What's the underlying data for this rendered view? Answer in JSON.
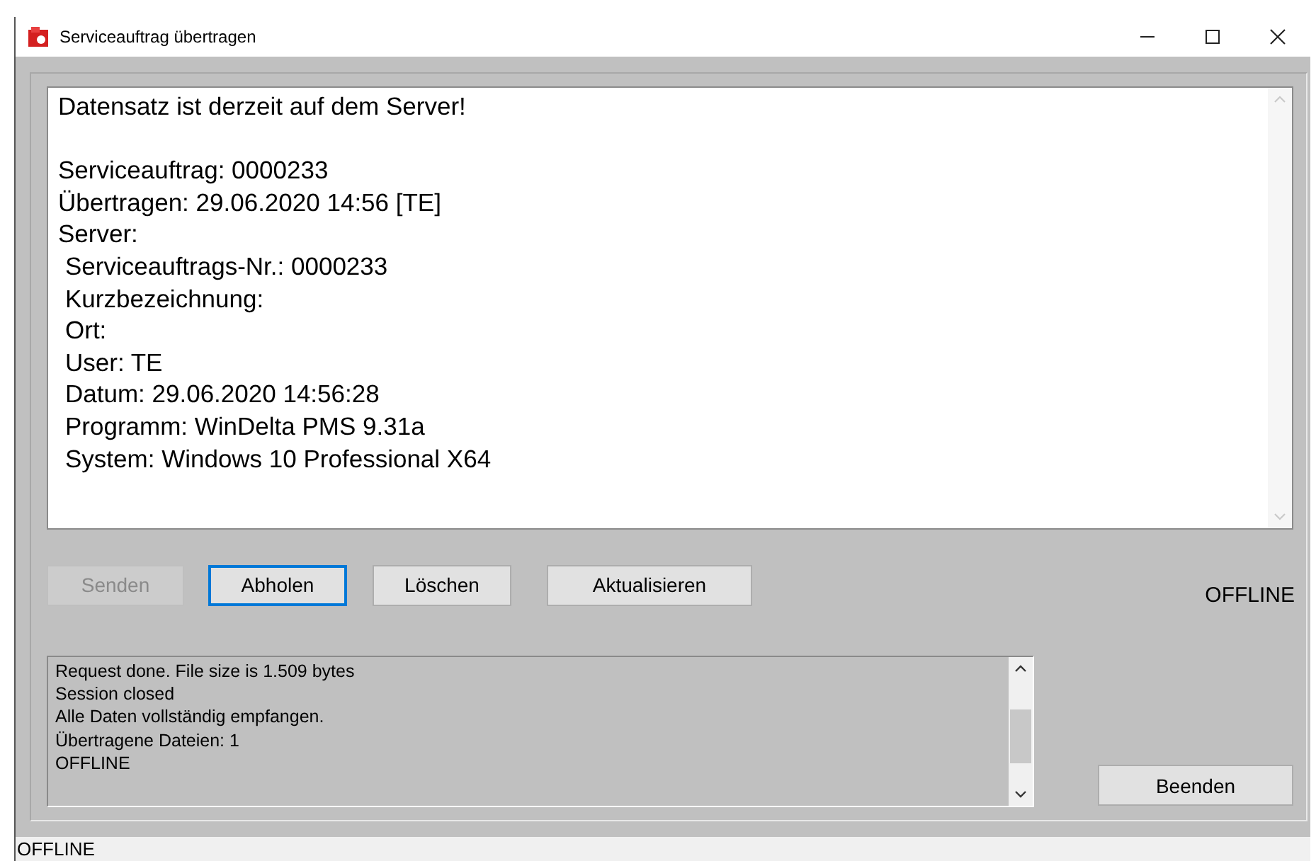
{
  "window": {
    "title": "Serviceauftrag übertragen"
  },
  "details": {
    "lines": [
      {
        "text": "Datensatz ist derzeit auf dem Server!",
        "kind": "heading"
      },
      {
        "text": "Serviceauftrag: 0000233",
        "kind": "plain"
      },
      {
        "text": "Übertragen: 29.06.2020 14:56 [TE]",
        "kind": "plain"
      },
      {
        "text": "Server:",
        "kind": "plain"
      },
      {
        "text": "Serviceauftrags-Nr.: 0000233",
        "kind": "indented"
      },
      {
        "text": "Kurzbezeichnung:",
        "kind": "indented"
      },
      {
        "text": "Ort:",
        "kind": "indented"
      },
      {
        "text": "User: TE",
        "kind": "indented"
      },
      {
        "text": "Datum: 29.06.2020 14:56:28",
        "kind": "indented"
      },
      {
        "text": "Programm: WinDelta PMS 9.31a",
        "kind": "indented"
      },
      {
        "text": "System: Windows 10 Professional X64",
        "kind": "indented"
      }
    ]
  },
  "buttons": [
    {
      "label": "Senden",
      "disabled": true,
      "focused": false
    },
    {
      "label": "Abholen",
      "disabled": false,
      "focused": true
    },
    {
      "label": "Löschen",
      "disabled": false,
      "focused": false
    },
    {
      "label": "Aktualisieren",
      "disabled": false,
      "focused": false
    }
  ],
  "connection_status": "OFFLINE",
  "log": {
    "lines": [
      "Request done. File size is 1.509 bytes",
      "Session closed",
      "Alle Daten vollständig empfangen.",
      "Übertragene Dateien: 1",
      "OFFLINE"
    ]
  },
  "close_button": "Beenden",
  "status_bar": "OFFLINE"
}
